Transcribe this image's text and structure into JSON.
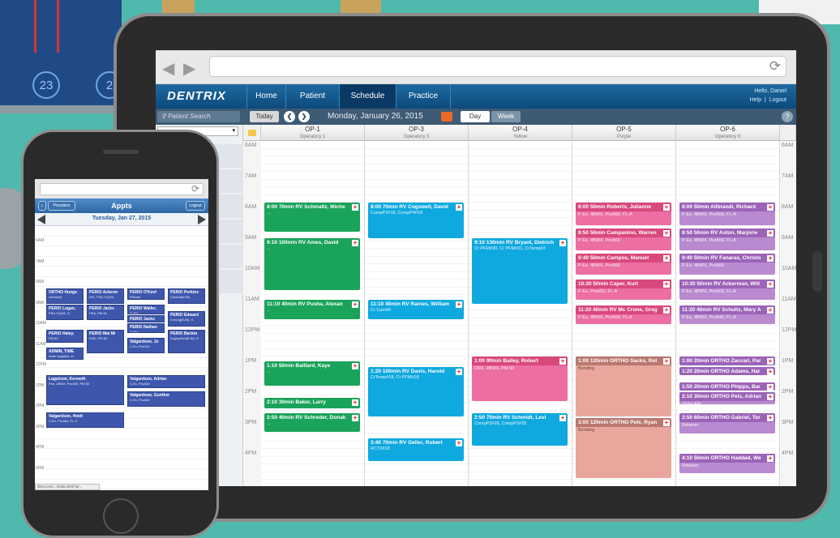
{
  "background": {
    "circle_numbers": [
      "23",
      "2"
    ]
  },
  "tablet": {
    "app_name": "DENTRIX",
    "nav_tabs": [
      "Home",
      "Patient",
      "Schedule",
      "Practice"
    ],
    "active_tab": "Schedule",
    "user": {
      "greeting": "Hello, Daniel",
      "help": "Help",
      "separator": "|",
      "logout": "Logout"
    },
    "toolbar": {
      "patient_search_placeholder": "Patient Search",
      "today_label": "Today",
      "prev_icon": "chevron-left-icon",
      "next_icon": "chevron-right-icon",
      "date": "Monday, January 26, 2015",
      "day_label": "Day",
      "week_label": "Week",
      "help_label": "?"
    },
    "times": [
      "6AM",
      "7AM",
      "8AM",
      "9AM",
      "10AM",
      "11AM",
      "12PM",
      "1PM",
      "2PM",
      "3PM",
      "4PM"
    ],
    "operatories": [
      {
        "name": "OP-1",
        "sub": "Operatory 1"
      },
      {
        "name": "OP-3",
        "sub": "Operatory 3"
      },
      {
        "name": "OP-4",
        "sub": "Yellow"
      },
      {
        "name": "OP-5",
        "sub": "Purple"
      },
      {
        "name": "OP-6",
        "sub": "Operatory 6"
      }
    ],
    "appointments": [
      {
        "op": 0,
        "start": 8.0,
        "end": 9.0,
        "color": "green",
        "title": "8:00 70min RV Schmaltz, Miche",
        "sub": "..."
      },
      {
        "op": 0,
        "start": 9.17,
        "end": 10.9,
        "color": "green",
        "title": "9:10 100min RV Ames, David",
        "sub": "..."
      },
      {
        "op": 0,
        "start": 11.17,
        "end": 11.85,
        "color": "green",
        "title": "11:10 40min RV Pusha, Alexan",
        "sub": "..."
      },
      {
        "op": 0,
        "start": 13.17,
        "end": 14.0,
        "color": "green",
        "title": "1:10 50min Baillard, Kaye",
        "sub": "..."
      },
      {
        "op": 0,
        "start": 14.33,
        "end": 14.75,
        "color": "green",
        "title": "2:10 30min Baker, Larry",
        "sub": ""
      },
      {
        "op": 0,
        "start": 14.83,
        "end": 15.5,
        "color": "green",
        "title": "2:50 40min RV Schreder, Donak",
        "sub": "..."
      },
      {
        "op": 1,
        "start": 8.0,
        "end": 9.2,
        "color": "blue",
        "title": "8:00 70min RV Cogswell, David",
        "sub": "CompP3#18, CompP4#18"
      },
      {
        "op": 1,
        "start": 11.17,
        "end": 11.85,
        "color": "blue",
        "title": "11:10 40min RV Raines, William",
        "sub": "Cr Cam#0"
      },
      {
        "op": 1,
        "start": 13.33,
        "end": 15.0,
        "color": "blue",
        "title": "1:20 100min RV Davis, Harold",
        "sub": "CrTemp#18, Cr PFM#18"
      },
      {
        "op": 1,
        "start": 15.67,
        "end": 16.45,
        "color": "blue",
        "title": "3:40 70min RV Geller, Robert",
        "sub": "RCT3#18"
      },
      {
        "op": 2,
        "start": 9.17,
        "end": 11.33,
        "color": "blue",
        "title": "9:10 130min RV Bryant, Dietrich",
        "sub": "Cr PFM#30, Cr PFM#31, CrTemp#3"
      },
      {
        "op": 2,
        "start": 13.0,
        "end": 14.5,
        "color": "pink",
        "title": "1:00 90min Bailey, Robert",
        "sub": "FMX, 2BWX, PM 60"
      },
      {
        "op": 2,
        "start": 14.83,
        "end": 15.95,
        "color": "blue",
        "title": "2:50 70min RV Schmidt, Levi",
        "sub": "CompP2#28, CompP2#29"
      },
      {
        "op": 3,
        "start": 8.0,
        "end": 8.8,
        "color": "pink",
        "title": "8:00 50min Roberts, Julianne",
        "sub": "P-Ex, 4BWX, ProA50, FL-A"
      },
      {
        "op": 3,
        "start": 8.83,
        "end": 9.6,
        "color": "pink",
        "title": "8:50 50min Campanino, Warren",
        "sub": "P-Ex, 4BWX, ProA50"
      },
      {
        "op": 3,
        "start": 9.67,
        "end": 10.4,
        "color": "pink",
        "title": "9:40 50min Campos, Manuel",
        "sub": "P-Ex, 4BWX, ProA50"
      },
      {
        "op": 3,
        "start": 10.5,
        "end": 11.2,
        "color": "pink",
        "title": "10:30 50min Caper, Kurt",
        "sub": "P-Ex, ProA50, FL-A"
      },
      {
        "op": 3,
        "start": 11.33,
        "end": 12.0,
        "color": "pink",
        "title": "11:20 40min RV Mc Crone, Greg",
        "sub": "P-Ex, 4BWX, ProA50, FL-A"
      },
      {
        "op": 3,
        "start": 13.0,
        "end": 15.0,
        "color": "tan",
        "title": "1:00 120min ORTHO Sacks, Rol",
        "sub": "Bending"
      },
      {
        "op": 3,
        "start": 15.0,
        "end": 17.0,
        "color": "tan",
        "title": "3:00 120min ORTHO Pels, Ryan",
        "sub": "Bending"
      },
      {
        "op": 4,
        "start": 8.0,
        "end": 8.8,
        "color": "purple",
        "title": "8:00 50min Allbrandi, Richard",
        "sub": "P-Ex, 4BWX, ProA50, FL-A"
      },
      {
        "op": 4,
        "start": 8.83,
        "end": 9.6,
        "color": "purple",
        "title": "8:50 50min RV Aston, Marjorie",
        "sub": "P-Ex, 4BWX, ProA50, FL-A"
      },
      {
        "op": 4,
        "start": 9.67,
        "end": 10.4,
        "color": "purple",
        "title": "9:40 50min RV Fanaras, Christo",
        "sub": "P-Ex, 4BWX, ProA50"
      },
      {
        "op": 4,
        "start": 10.5,
        "end": 11.2,
        "color": "purple",
        "title": "10:30 50min RV Ackerman, Will",
        "sub": "P-Ex, 4BWX, ProA50, FL-A"
      },
      {
        "op": 4,
        "start": 11.33,
        "end": 12.0,
        "color": "purple",
        "title": "11:20 40min RV Schultz, Mary A",
        "sub": "P-Ex, 4BWX, ProA40, FL-A"
      },
      {
        "op": 4,
        "start": 13.0,
        "end": 13.33,
        "color": "purple",
        "title": "1:00 20min ORTHO Zaccari, Par",
        "sub": ""
      },
      {
        "op": 4,
        "start": 13.33,
        "end": 13.67,
        "color": "purple",
        "title": "1:20 20min ORTHO Adams, Har",
        "sub": ""
      },
      {
        "op": 4,
        "start": 13.83,
        "end": 14.17,
        "color": "purple",
        "title": "1:50 20min ORTHO Phipps, Bar",
        "sub": ""
      },
      {
        "op": 4,
        "start": 14.17,
        "end": 14.6,
        "color": "purple",
        "title": "2:10 30min ORTHO Pels, Adrian",
        "sub": "Ortho Adj"
      },
      {
        "op": 4,
        "start": 14.83,
        "end": 15.55,
        "color": "purple",
        "title": "2:50 60min ORTHO Gabriel, Tor",
        "sub": "Retainer"
      },
      {
        "op": 4,
        "start": 16.17,
        "end": 16.85,
        "color": "purple",
        "title": "4:10 50min ORTHO Haddad, We",
        "sub": "Retainer"
      }
    ]
  },
  "phone": {
    "providers_label": "Providers",
    "title": "Appts",
    "logout_label": "Logout",
    "date": "Tuesday, Jan 27, 2015",
    "times": [
      "6AM",
      "7AM",
      "8AM",
      "9AM",
      "10AM",
      "11AM",
      "12PM",
      "1PM",
      "2PM",
      "3PM",
      "4PM",
      "5PM"
    ],
    "appointments": [
      {
        "col": 0,
        "start": 8.4,
        "end": 9.2,
        "title": "ORTHO Hunge",
        "sub": "OrthoAdj"
      },
      {
        "col": 1,
        "start": 8.4,
        "end": 9.2,
        "title": "PERIO Ackerm",
        "sub": "D/C, PSA YQ/VA,"
      },
      {
        "col": 2,
        "start": 8.4,
        "end": 9.0,
        "title": "PERIO O'Keef",
        "sub": "PDenal"
      },
      {
        "col": 3,
        "start": 8.4,
        "end": 9.2,
        "title": "PERIO Perkins",
        "sub": "ClinSub(EJN)"
      },
      {
        "col": 0,
        "start": 9.2,
        "end": 10.0,
        "title": "PERIO Logan,",
        "sub": "PSA YQ/VA, G"
      },
      {
        "col": 1,
        "start": 9.2,
        "end": 10.0,
        "title": "PERIO Jacks",
        "sub": "PSA, PM 60"
      },
      {
        "col": 2,
        "start": 9.2,
        "end": 9.7,
        "title": "PERIO Waller,",
        "sub": "Sulfen"
      },
      {
        "col": 2,
        "start": 9.7,
        "end": 10.1,
        "title": "PERIO Jacks",
        "sub": ""
      },
      {
        "col": 3,
        "start": 9.5,
        "end": 10.3,
        "title": "PERIO Edward",
        "sub": "CrnLng(EJN), G"
      },
      {
        "col": 2,
        "start": 10.1,
        "end": 10.6,
        "title": "PERIO Nathan",
        "sub": "Sulfen"
      },
      {
        "col": 0,
        "start": 10.4,
        "end": 11.1,
        "title": "PERIO Haley,",
        "sub": "PM 60"
      },
      {
        "col": 1,
        "start": 10.4,
        "end": 11.6,
        "title": "PERIO Mai Mi",
        "sub": "FMX, PM 60"
      },
      {
        "col": 3,
        "start": 10.4,
        "end": 11.6,
        "title": "PERIO Backm",
        "sub": "ScgmpEnd(EJN), G"
      },
      {
        "col": 2,
        "start": 10.8,
        "end": 11.6,
        "title": "Valgardson, Jo",
        "sub": "C-Ex, ProC40"
      },
      {
        "col": 0,
        "start": 11.3,
        "end": 11.9,
        "title": "ADMIN, TIME",
        "sub": "order supplies, et"
      },
      {
        "col": 0,
        "start": 12.6,
        "end": 14.1,
        "title": "Lagstrom, Kenneth",
        "sub": "Pan, 2BWX, ProA50, PM 60"
      },
      {
        "col": 2,
        "start": 12.6,
        "end": 13.3,
        "title": "Valgardson, Adrian",
        "sub": "C-Ex, ProA40"
      },
      {
        "col": 2,
        "start": 13.4,
        "end": 14.2,
        "title": "Valgardson, Gunther",
        "sub": "C-Ex, ProA40"
      },
      {
        "col": 0,
        "start": 14.4,
        "end": 15.2,
        "title": "Valgardson, Heidi",
        "sub": "C-Ex, ProA50, FL-C"
      }
    ],
    "status_url": "dent.com/.../index.html?pr..."
  }
}
